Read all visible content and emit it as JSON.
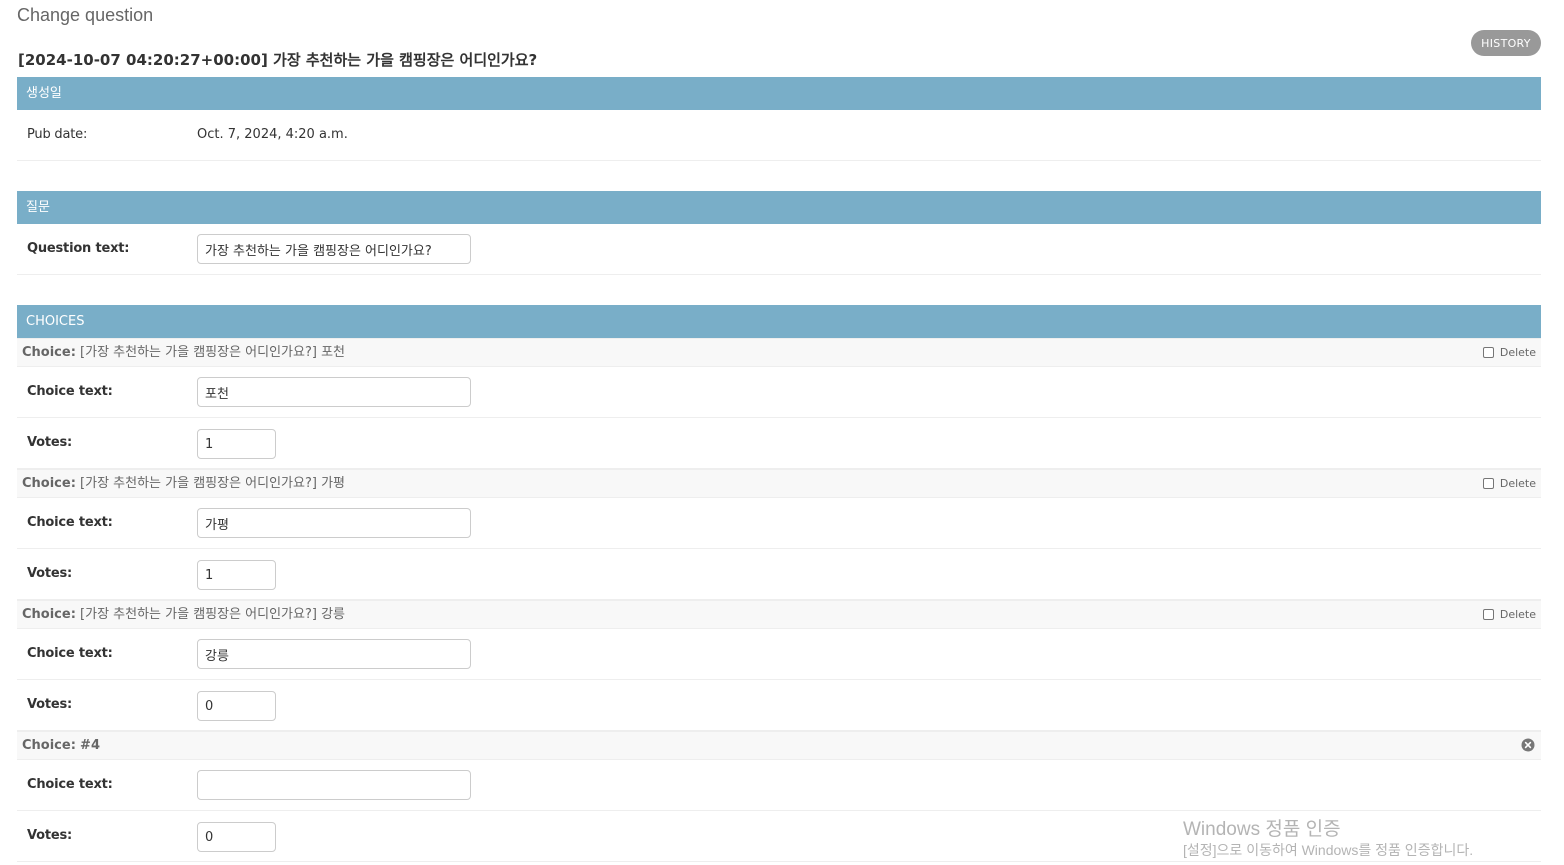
{
  "page": {
    "heading": "Change question",
    "history_label": "HISTORY",
    "object_title": "[2024-10-07 04:20:27+00:00] 가장 추천하는 가을 캠핑장은 어디인가요?"
  },
  "date_fieldset": {
    "caption": "생성일",
    "pub_date_label": "Pub date:",
    "pub_date_value": "Oct. 7, 2024, 4:20 a.m."
  },
  "question_fieldset": {
    "caption": "질문",
    "question_text_label": "Question text:",
    "question_text_value": "가장 추천하는 가을 캠핑장은 어디인가요?"
  },
  "choices": {
    "caption": "CHOICES",
    "choice_text_label": "Choice text:",
    "votes_label": "Votes:",
    "delete_label": "Delete",
    "items": [
      {
        "prefix": "Choice:",
        "title": "[가장 추천하는 가을 캠핑장은 어디인가요?] 포천",
        "choice_text": "포천",
        "votes": "1"
      },
      {
        "prefix": "Choice:",
        "title": "[가장 추천하는 가을 캠핑장은 어디인가요?] 가평",
        "choice_text": "가평",
        "votes": "1"
      },
      {
        "prefix": "Choice:",
        "title": "[가장 추천하는 가을 캠핑장은 어디인가요?] 강릉",
        "choice_text": "강릉",
        "votes": "0"
      },
      {
        "prefix": "Choice:",
        "title": "#4",
        "choice_text": "",
        "votes": "0"
      }
    ]
  },
  "watermark": {
    "line1": "Windows 정품 인증",
    "line2": "[설정]으로 이동하여 Windows를 정품 인증합니다."
  },
  "colors": {
    "module_header": "#79aec8",
    "history_button": "#999999",
    "inline_header_bg": "#f8f8f8"
  },
  "icons": {
    "delete_checkbox": "checkbox",
    "remove_inline": "x-circle-icon"
  }
}
